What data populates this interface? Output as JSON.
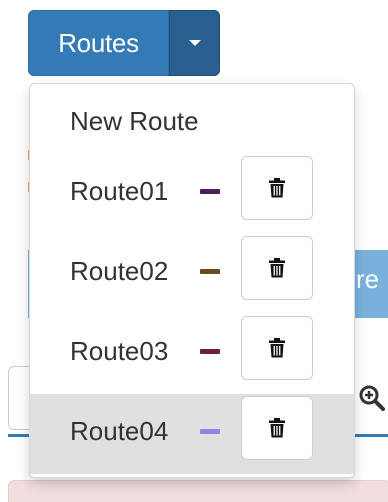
{
  "routes_button": {
    "label": "Routes"
  },
  "dropdown": {
    "new_route_label": "New Route",
    "routes": [
      {
        "label": "Route01",
        "color": "#4a1f5c"
      },
      {
        "label": "Route02",
        "color": "#6b4a22"
      },
      {
        "label": "Route03",
        "color": "#6e1f3a"
      },
      {
        "label": "Route04",
        "color": "#8a87e6"
      }
    ],
    "active_index": 3,
    "delete_icon": "trash-icon"
  },
  "background": {
    "partial_text": "re"
  },
  "colors": {
    "primary": "#337ab7",
    "primary_dark": "#286090",
    "active_row": "#e0e0e0",
    "alert_bg": "#f2dede"
  }
}
